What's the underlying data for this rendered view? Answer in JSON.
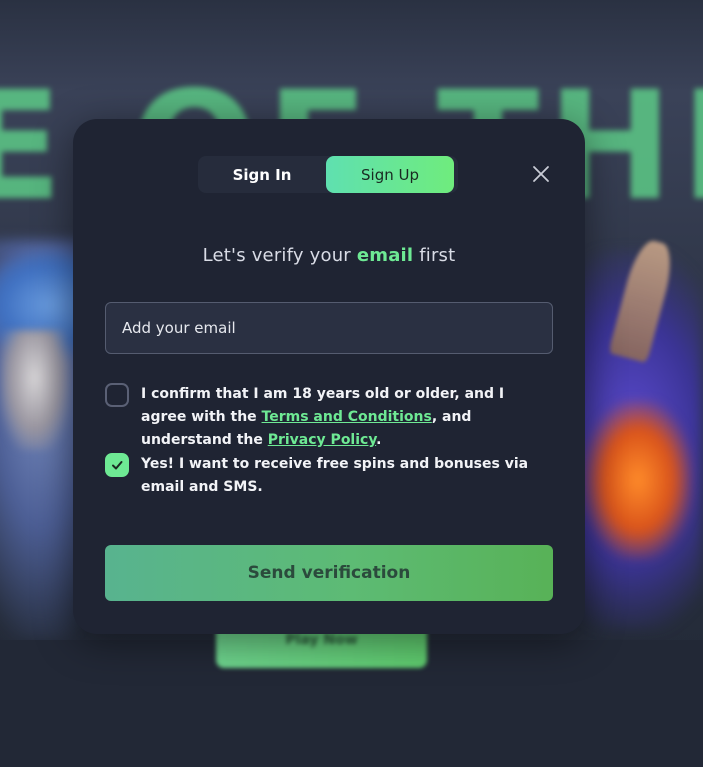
{
  "background": {
    "banner_text": "E OF THE W",
    "play_button_label": "Play Now"
  },
  "modal": {
    "tabs": [
      {
        "label": "Sign In",
        "active": false
      },
      {
        "label": "Sign Up",
        "active": true
      }
    ],
    "close_icon": "close-icon",
    "headline": {
      "prefix": "Let's verify your ",
      "accent": "email",
      "suffix": " first"
    },
    "email_input": {
      "placeholder": "Add your email",
      "value": ""
    },
    "age_confirm": {
      "checked": false,
      "text_before": "I confirm that I am 18 years old or older, and I agree with the ",
      "terms_link": "Terms and Conditions",
      "text_middle": ", and understand the ",
      "privacy_link": "Privacy Policy",
      "text_after": "."
    },
    "marketing_opt_in": {
      "checked": true,
      "text": "Yes! I want to receive free spins and bonuses via email and SMS."
    },
    "submit_label": "Send verification"
  },
  "colors": {
    "accent_green": "#6ee994",
    "modal_bg": "#1f2433",
    "input_bg": "#2a3042"
  }
}
